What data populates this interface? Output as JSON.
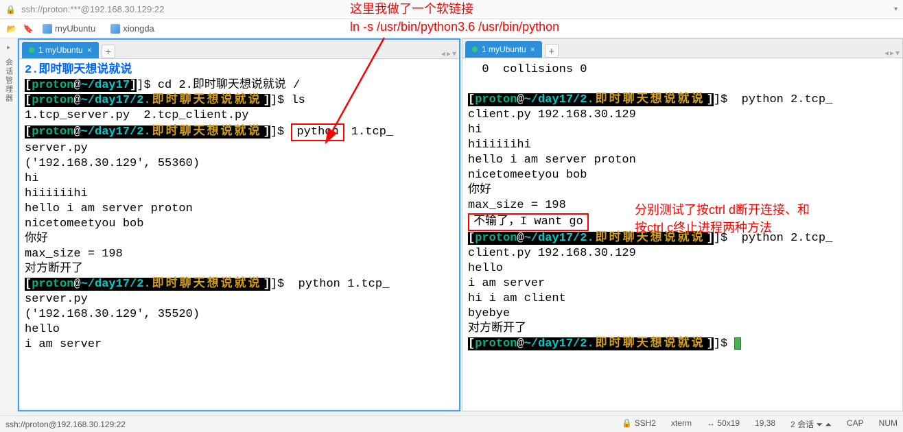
{
  "title": "ssh://proton:***@192.168.30.129:22",
  "toolbar": {
    "items": [
      "myUbuntu",
      "xiongda"
    ]
  },
  "sidebar_label": "会话管理器",
  "leftTab": "1 myUbuntu",
  "rightTab": "1 myUbuntu",
  "annot1": {
    "l1": "这里我做了一个软链接",
    "l2": "ln -s /usr/bin/python3.6 /usr/bin/python"
  },
  "annot2": {
    "l1": "分别测试了按ctrl d断开连接、和",
    "l2": "按ctrl c终止进程两种方法"
  },
  "left": {
    "dir_header": "2.即时聊天想说就说",
    "cmd1": "cd 2.即时聊天想说就说 /",
    "cmd2": "ls",
    "files": "1.tcp_server.py  2.tcp_client.py",
    "python_box": "python",
    "run1_tail": " 1.tcp_",
    "server_py": "server.py",
    "addr1": "('192.168.30.129', 55360)",
    "o1": "hi",
    "o2": "hiiiiiihi",
    "o3": "hello i am server proton",
    "o4": "nicetomeetyou bob",
    "o5": "你好",
    "o6": "max_size = 198",
    "o7": "对方断开了",
    "run2": " python 1.tcp_",
    "addr2": "('192.168.30.129', 35520)",
    "p1": "hello",
    "p2": "i am server",
    "prompt_user": "proton",
    "prompt_at": "@",
    "prompt_path_short": "~/day17",
    "prompt_path_long": "~/day17/2.",
    "prompt_cn": "即时聊天想说就说",
    "prompt_end": "]$ "
  },
  "right": {
    "top": "  0  collisions 0",
    "run_tail": " python 2.tcp_",
    "client_line": "client.py 192.168.30.129",
    "r1": "hi",
    "r2": "hiiiiiihi",
    "r3": "hello i am server proton",
    "r4": "nicetomeetyou bob",
    "r5": "你好",
    "r6": "max_size = 198",
    "r7_box": "不输了，I want go",
    "s1": "hello",
    "s2": "i am server",
    "s3": "hi i am client",
    "s4": "byebye",
    "s5": "对方断开了"
  },
  "status": {
    "left": "ssh://proton@192.168.30.129:22",
    "ssh": "SSH2",
    "term": "xterm",
    "size": "50x19",
    "pos": "19,38",
    "sess": "2 会话",
    "cap": "CAP",
    "num": "NUM"
  }
}
